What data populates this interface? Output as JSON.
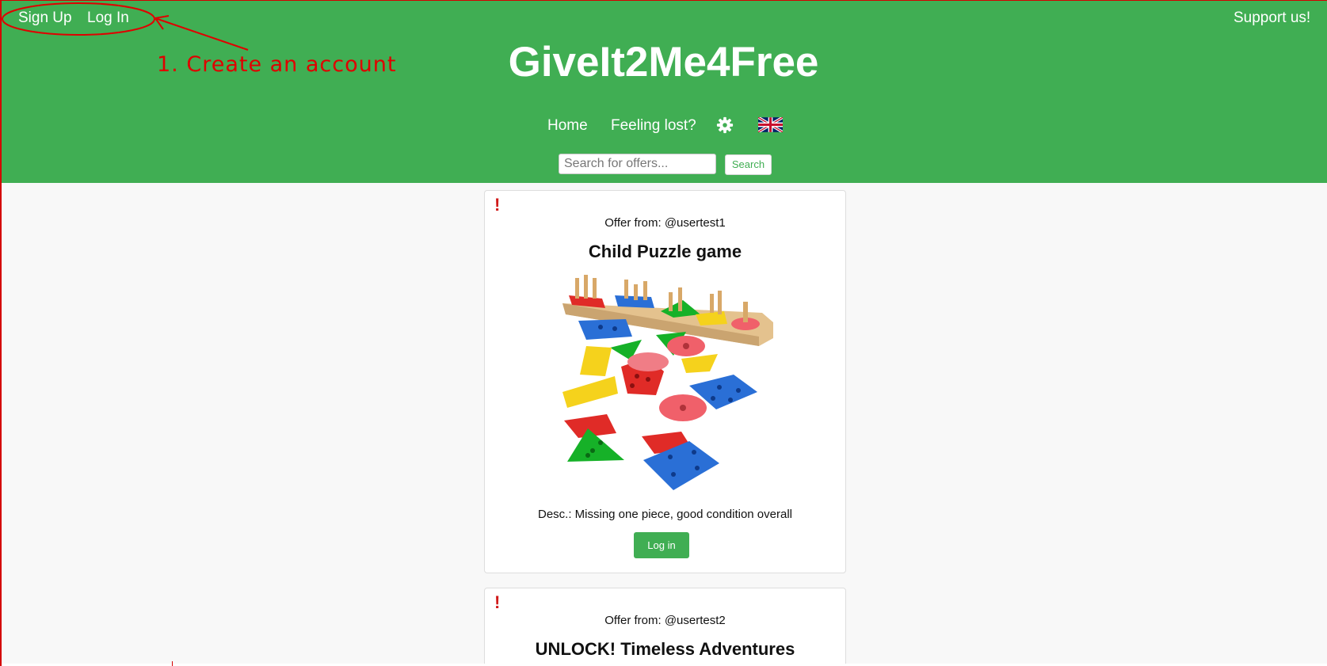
{
  "header": {
    "signup_label": "Sign Up",
    "login_label": "Log In",
    "support_label": "Support us!",
    "site_title": "GiveIt2Me4Free",
    "nav": {
      "home": "Home",
      "feeling_lost": "Feeling lost?",
      "settings_icon": "gear-icon",
      "language_icon": "uk-flag-icon"
    },
    "search": {
      "placeholder": "Search for offers...",
      "value": "",
      "button_label": "Search"
    }
  },
  "annotation": {
    "text": "1. Create an account",
    "color": "#e00000"
  },
  "offers": [
    {
      "report_mark": "!",
      "offer_from": "Offer from: @usertest1",
      "title": "Child Puzzle game",
      "description": "Desc.: Missing one piece, good condition overall",
      "action_label": "Log in"
    },
    {
      "report_mark": "!",
      "offer_from": "Offer from: @usertest2",
      "title": "UNLOCK! Timeless Adventures"
    }
  ],
  "colors": {
    "brand_green": "#40ae53",
    "background": "#f8f8f8",
    "report_red": "#d01919"
  }
}
